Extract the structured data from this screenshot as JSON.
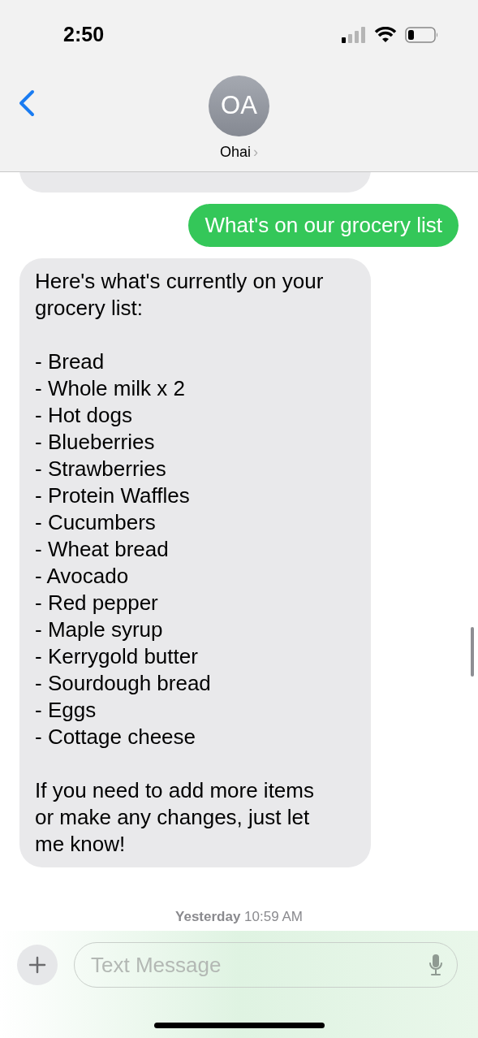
{
  "status_bar": {
    "time": "2:50"
  },
  "header": {
    "avatar_initials": "OA",
    "contact_name": "Ohai",
    "chevron": "›"
  },
  "messages": [
    {
      "kind": "sent",
      "paragraphs": [
        [
          "What's on our grocery list"
        ]
      ]
    },
    {
      "kind": "received",
      "paragraphs": [
        [
          "Here's what's currently on your grocery list:"
        ],
        [
          "- Bread",
          "- Whole milk x 2",
          "- Hot dogs",
          "- Blueberries",
          "- Strawberries",
          "- Protein Waffles",
          "- Cucumbers",
          "- Wheat bread",
          "- Avocado",
          "- Red pepper",
          "- Maple syrup",
          "- Kerrygold butter",
          "- Sourdough bread",
          "- Eggs",
          "- Cottage cheese"
        ],
        [
          "If you need to add more items or make any changes, just let me know!"
        ]
      ]
    }
  ],
  "timestamp": "**Yesterday** 10:59 AM",
  "composer": {
    "placeholder": "Text Message"
  }
}
